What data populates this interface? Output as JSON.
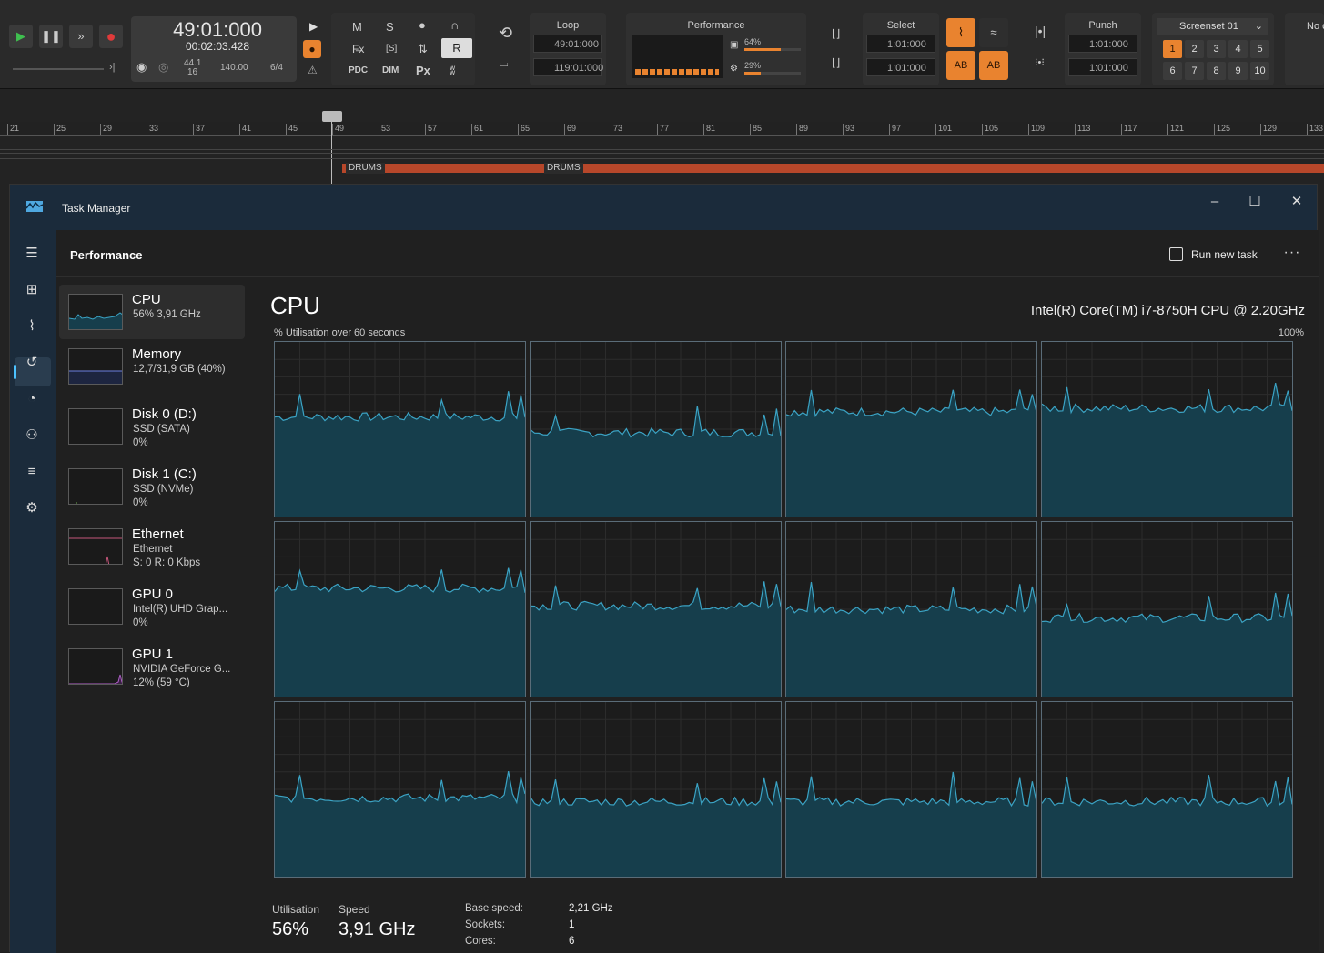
{
  "daw": {
    "transport": {
      "position_bars": "49:01:000",
      "position_time": "00:02:03.428",
      "sample_rate": "44.1",
      "bit_depth": "16",
      "tempo": "140.00",
      "time_signature": "6/4",
      "monitor_labels": [
        "M",
        "S",
        "PDC",
        "[S]",
        "DIM",
        "Px",
        "R"
      ],
      "loop_title": "Loop",
      "loop_start": "49:01:000",
      "loop_end": "119:01:000",
      "performance_title": "Performance",
      "performance_cpu": "64%",
      "performance_disk": "29%",
      "select_title": "Select",
      "select_start": "1:01:000",
      "select_end": "1:01:000",
      "punch_title": "Punch",
      "punch_start": "1:01:000",
      "punch_end": "1:01:000",
      "screenset_title": "Screenset 01",
      "screenset_buttons": [
        "1",
        "2",
        "3",
        "4",
        "5",
        "6",
        "7",
        "8",
        "9",
        "10"
      ],
      "cut_off_label": "No c"
    },
    "ruler_bars": [
      "21",
      "25",
      "29",
      "33",
      "37",
      "41",
      "45",
      "49",
      "53",
      "57",
      "61",
      "65",
      "69",
      "73",
      "77",
      "81",
      "85",
      "89",
      "93",
      "97",
      "101",
      "105",
      "109",
      "113",
      "117",
      "121",
      "125",
      "129",
      "133"
    ],
    "clip_labels": [
      "DRUMS",
      "DRUMS"
    ],
    "colors": {
      "clip": "#b7472a",
      "accent": "#e9832f"
    }
  },
  "task_manager": {
    "window_title": "Task Manager",
    "page_heading": "Performance",
    "run_new_task": "Run new task",
    "more_label": "···",
    "nav_icons": [
      "hamburger-icon",
      "processes-icon",
      "performance-icon",
      "app-history-icon",
      "startup-apps-icon",
      "users-icon",
      "details-icon",
      "services-icon"
    ],
    "resources": [
      {
        "name": "CPU",
        "sub1": "56% 3,91 GHz",
        "sub2": ""
      },
      {
        "name": "Memory",
        "sub1": "12,7/31,9 GB (40%)",
        "sub2": ""
      },
      {
        "name": "Disk 0 (D:)",
        "sub1": "SSD (SATA)",
        "sub2": "0%"
      },
      {
        "name": "Disk 1 (C:)",
        "sub1": "SSD (NVMe)",
        "sub2": "0%"
      },
      {
        "name": "Ethernet",
        "sub1": "Ethernet",
        "sub2": "S: 0 R: 0 Kbps"
      },
      {
        "name": "GPU 0",
        "sub1": "Intel(R) UHD Grap...",
        "sub2": "0%"
      },
      {
        "name": "GPU 1",
        "sub1": "NVIDIA GeForce G...",
        "sub2": "12% (59 °C)"
      }
    ],
    "cpu": {
      "title": "CPU",
      "model": "Intel(R) Core(TM) i7-8750H CPU @ 2.20GHz",
      "graph_label": "% Utilisation over 60 seconds",
      "graph_max": "100%",
      "core_count_graphs": 12,
      "utilisation_label": "Utilisation",
      "utilisation_value": "56%",
      "speed_label": "Speed",
      "speed_value": "3,91 GHz",
      "base_speed_label": "Base speed:",
      "base_speed_value": "2,21 GHz",
      "sockets_label": "Sockets:",
      "sockets_value": "1",
      "cores_label": "Cores:",
      "cores_value": "6"
    },
    "colors": {
      "titlebar": "#1b2b3b",
      "graph_line": "#3ba3c4",
      "graph_fill": "#163e4c",
      "memory_line": "#6b7fe0",
      "ethernet_line": "#c4567a",
      "gpu_line": "#b05fc8"
    }
  }
}
